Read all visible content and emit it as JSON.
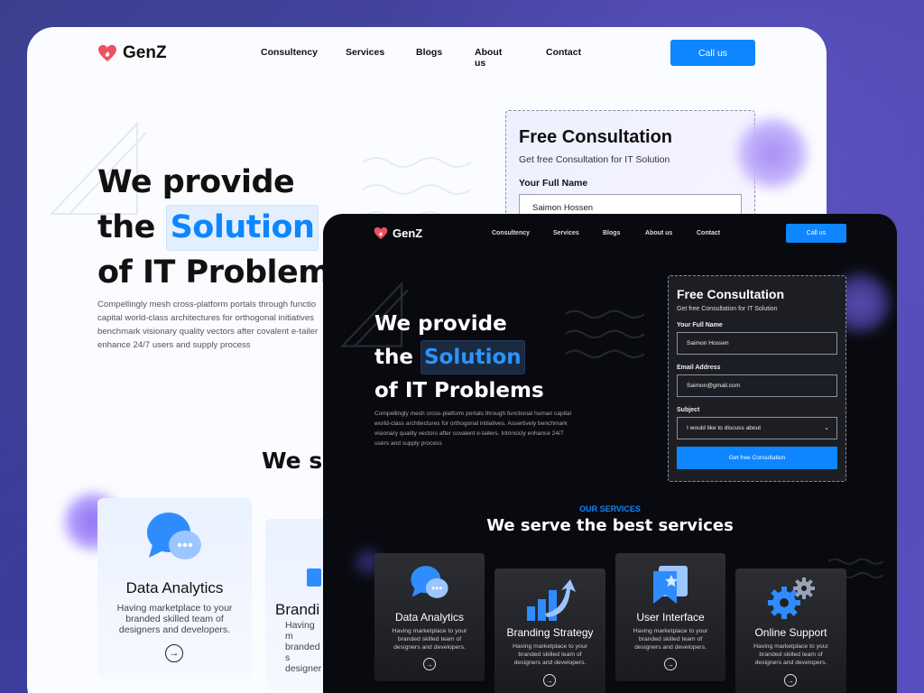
{
  "brand": {
    "name": "GenZ",
    "accent": "#0d86ff",
    "heart_color": "#ef4f5f"
  },
  "nav": {
    "links": [
      "Consultency",
      "Services",
      "Blogs",
      "About us",
      "Contact"
    ],
    "cta": "Call us"
  },
  "hero": {
    "line1": "We provide",
    "line2_pre": "the",
    "highlight": "Solution",
    "line3": "of IT Problems",
    "paragraph": "Compellingly mesh cross-platform portals through functional human capital world-class architectures for orthogonal initiatives. Assertively benchmark visionary quality vectors after covalent e-tailers. Intrinsicly enhance 24/7 users and supply process"
  },
  "light_preview": {
    "hero_line3": "of IT Problems",
    "paragraph": "Compellingly mesh cross-platform portals through functio capital world-class architectures for orthogonal initiatives benchmark visionary quality vectors after covalent e-tailer enhance 24/7 users and supply process",
    "serve_partial": "We se",
    "card2_title_partial": "Brandi",
    "card2_desc_partial": "Having m branded s designer"
  },
  "form": {
    "title": "Free Consultation",
    "subtitle": "Get free Consultation for IT Solution",
    "name_label": "Your Full Name",
    "name_value": "Saimon Hossen",
    "email_label": "Email Address",
    "email_value": "Saimon@gmail.com",
    "subject_label": "Subject",
    "subject_value": "I would like to discuss about",
    "submit": "Get free Consultation"
  },
  "services": {
    "eyebrow": "OUR SERVICES",
    "title": "We serve the best services",
    "items": [
      {
        "title": "Data Analytics",
        "desc": "Having marketplace to your branded skilled team of designers and developers.",
        "icon": "chat-bubbles-icon"
      },
      {
        "title": "Branding Strategy",
        "desc": "Having marketplace to your branded skilled team of designers and developers.",
        "icon": "growth-chart-icon"
      },
      {
        "title": "User Interface",
        "desc": "Having marketplace to your branded skilled team of designers and developers.",
        "icon": "bookmark-star-icon"
      },
      {
        "title": "Online Support",
        "desc": "Having marketplace to your branded skilled team of designers and developers.",
        "icon": "gears-icon"
      }
    ]
  }
}
